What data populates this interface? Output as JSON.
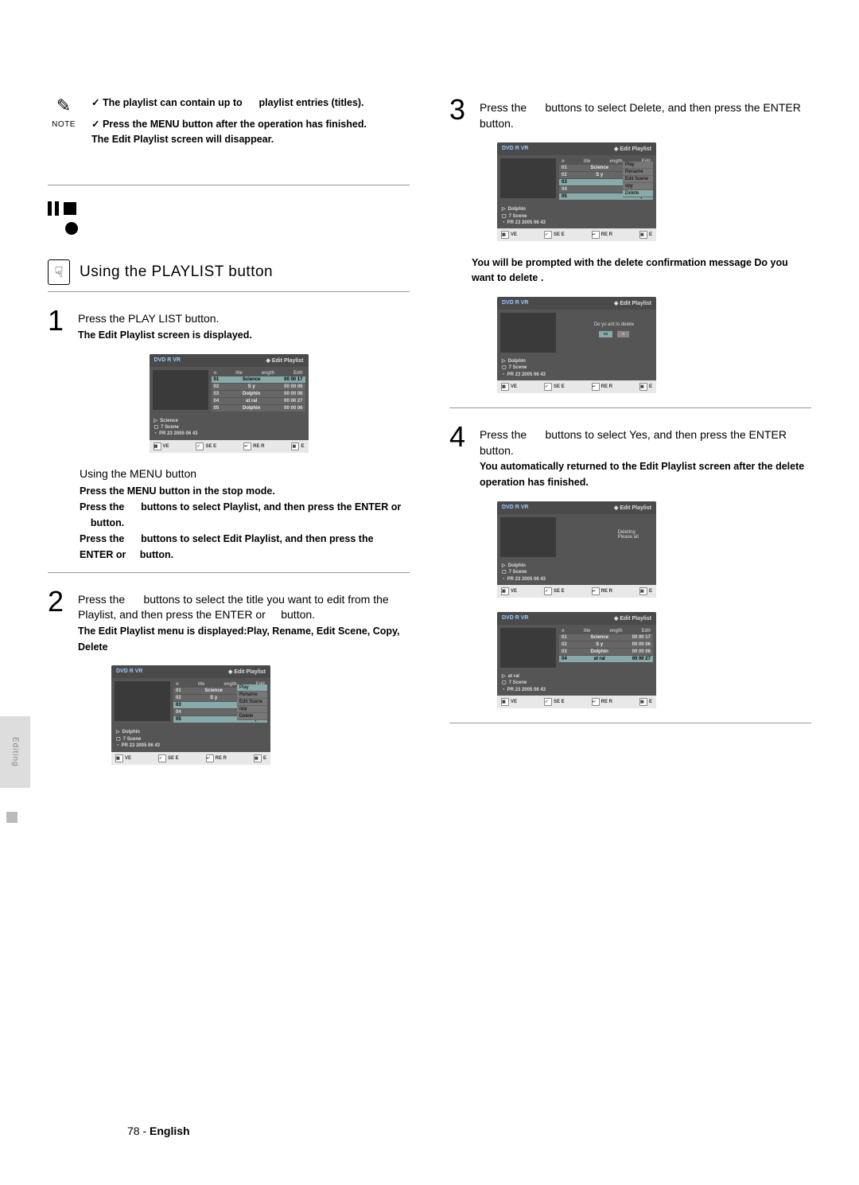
{
  "note": {
    "label": "NOTE",
    "line1_a": "The playlist can contain up to",
    "line1_b": "playlist entries (titles).",
    "line2": "Press the MENU button after the operation has finished.",
    "line3": "The Edit Playlist screen will disappear."
  },
  "heading": "Using the PLAYLIST button",
  "step1": {
    "num": "1",
    "text": "Press the PLAY LIST button.",
    "bold": "The Edit Playlist screen is displayed."
  },
  "menu_sub": {
    "heading": "Using the MENU button",
    "l1": "Press the MENU button in the stop mode.",
    "l2a": "Press the",
    "l2b": "buttons to select Playlist, and then press the ENTER or",
    "l2c": "button.",
    "l3a": "Press the",
    "l3b": "buttons to select Edit Playlist, and then press the ENTER or",
    "l3c": "button."
  },
  "step2": {
    "num": "2",
    "text_a": "Press the",
    "text_b": "buttons to select the title you want to edit from the Playlist, and then press the ENTER or",
    "text_c": "button.",
    "bold": "The Edit Playlist menu is displayed:Play, Rename, Edit Scene, Copy, Delete"
  },
  "step3": {
    "num": "3",
    "text_a": "Press the",
    "text_b": "buttons to select Delete, and then press the ENTER button."
  },
  "prompt3": "You will be prompted with the delete confirmation message  Do you want to delete  .",
  "step4": {
    "num": "4",
    "text_a": "Press the",
    "text_b": "buttons to select Yes, and then press the ENTER button.",
    "bold": "You automatically returned to the Edit Playlist screen after the delete operation has finished."
  },
  "screen_common": {
    "top_left": "DVD R    VR",
    "top_right": "Edit Playlist",
    "col_no": "o",
    "col_title": "itle",
    "col_len": "ength",
    "col_edit": "Edit",
    "footer_move": "VE",
    "footer_select": "SE E",
    "footer_return": "RE  R",
    "footer_exit": "E"
  },
  "rows": [
    {
      "no": "01",
      "name": "Science",
      "len": "00 00 17"
    },
    {
      "no": "02",
      "name": "S y",
      "len": "00 00 06"
    },
    {
      "no": "03",
      "name": "Dolphin",
      "len": "00 00 06"
    },
    {
      "no": "04",
      "name": "at ral",
      "len": "00 00 27"
    },
    {
      "no": "05",
      "name": "Dolphin",
      "len": "00 00 06"
    }
  ],
  "info1": {
    "title": "Science",
    "scenes": "7 Scene",
    "date": "PR  23  2005 06 43"
  },
  "info2": {
    "title": "Dolphin",
    "scenes": "7 Scene",
    "date": "PR  23  2005 06 43"
  },
  "info3": {
    "title": "at ral",
    "scenes": "7 Scene",
    "date": "PR  23  2005 06 43"
  },
  "menu_items": [
    "Play",
    "Rename",
    "Edit Scene",
    "opy",
    "Delete"
  ],
  "dialog": {
    "msg": "Do yo    ant to delete",
    "yes": "es",
    "no": "o"
  },
  "wait": {
    "l1": "Deleting",
    "l2": "Please   ait"
  },
  "footer": {
    "page": "78 -",
    "lang": "English"
  },
  "side_tab": "Editing"
}
